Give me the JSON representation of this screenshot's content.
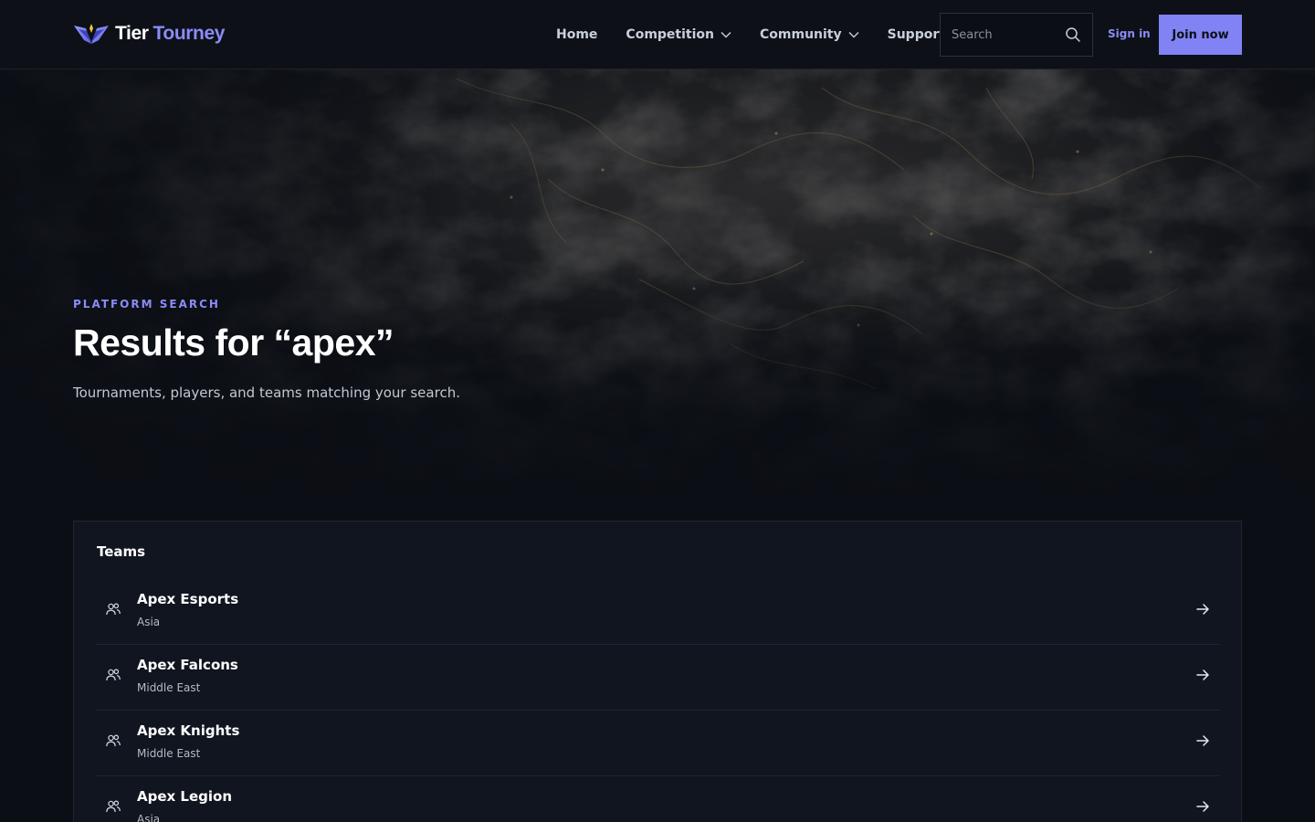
{
  "brand": {
    "name_part1": "Tier",
    "name_part2": "Tourney",
    "logo_icon": "winged-v-logo-icon",
    "accent_color": "#8b8cf8",
    "logo_gold": "#f5c044"
  },
  "nav": {
    "items": [
      {
        "label": "Home",
        "has_dropdown": false
      },
      {
        "label": "Competition",
        "has_dropdown": true
      },
      {
        "label": "Community",
        "has_dropdown": true
      },
      {
        "label": "Support",
        "has_dropdown": false
      }
    ]
  },
  "search": {
    "placeholder": "Search",
    "value": "",
    "icon": "search-icon"
  },
  "auth": {
    "signin_label": "Sign in",
    "join_label": "Join now",
    "join_color": "#8183f4"
  },
  "hero": {
    "eyebrow": "PLATFORM SEARCH",
    "title": "Results for “apex”",
    "subtitle": "Tournaments, players, and teams matching your search."
  },
  "results": {
    "section_title": "Teams",
    "row_icon": "users-icon",
    "row_action_icon": "arrow-right-icon",
    "teams": [
      {
        "name": "Apex Esports",
        "region": "Asia"
      },
      {
        "name": "Apex Falcons",
        "region": "Middle East"
      },
      {
        "name": "Apex Knights",
        "region": "Middle East"
      },
      {
        "name": "Apex Legion",
        "region": "Asia"
      }
    ]
  },
  "colors": {
    "page_bg": "#0b0e14",
    "header_bg": "#0d1017",
    "panel_bg": "#101520",
    "border": "#1f2532"
  }
}
